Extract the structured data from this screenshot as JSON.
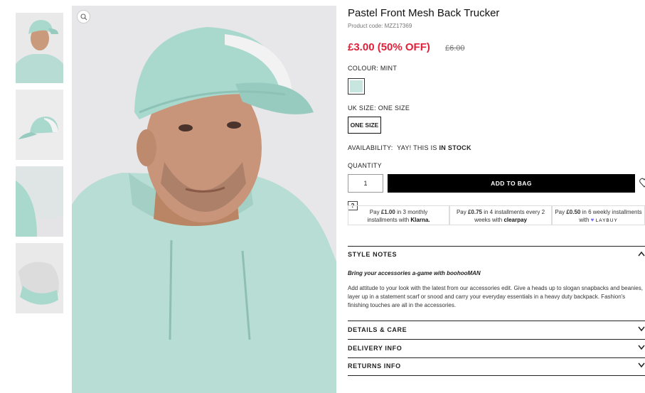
{
  "product": {
    "title": "Pastel Front Mesh Back Trucker",
    "code": "Product code: MZZ17369",
    "price": "£3.00 (50% OFF)",
    "was_price": "£6.00"
  },
  "colour": {
    "label": "COLOUR:",
    "value": "MINT",
    "swatch_color": "#c7e6df"
  },
  "size": {
    "label": "UK SIZE:",
    "value": "ONE SIZE",
    "option": "ONE SIZE"
  },
  "availability": {
    "label": "AVAILABILITY:",
    "text": "YAY! THIS IS",
    "status": "IN STOCK"
  },
  "quantity": {
    "label": "QUANTITY",
    "value": "1"
  },
  "add_to_bag": "ADD TO BAG",
  "help": "?",
  "payments": [
    {
      "line1_pre": "Pay ",
      "amount": "£1.00",
      "line1_post": " in 3 monthly",
      "line2": "installments with ",
      "brand": "Klarna."
    },
    {
      "line1_pre": "Pay ",
      "amount": "£0.75",
      "line1_post": " in 4 installments every 2",
      "line2": "weeks with ",
      "brand": "clearpay"
    },
    {
      "line1_pre": "Pay ",
      "amount": "£0.50",
      "line1_post": " in 6 weekly installments",
      "line2": "with ",
      "brand": "LAYBUY"
    }
  ],
  "style_notes": {
    "heading": "STYLE NOTES",
    "subtitle": "Bring your accessories a-game with boohooMAN",
    "body": "Add attitude to your look with the latest from our accessories edit. Give a heads up to slogan snapbacks and beanies, layer up in a statement scarf or snood and carry your everyday essentials in a heavy duty backpack. Fashion's finishing touches are all in the accessories."
  },
  "accordions": [
    "DETAILS & CARE",
    "DELIVERY INFO",
    "RETURNS INFO"
  ]
}
